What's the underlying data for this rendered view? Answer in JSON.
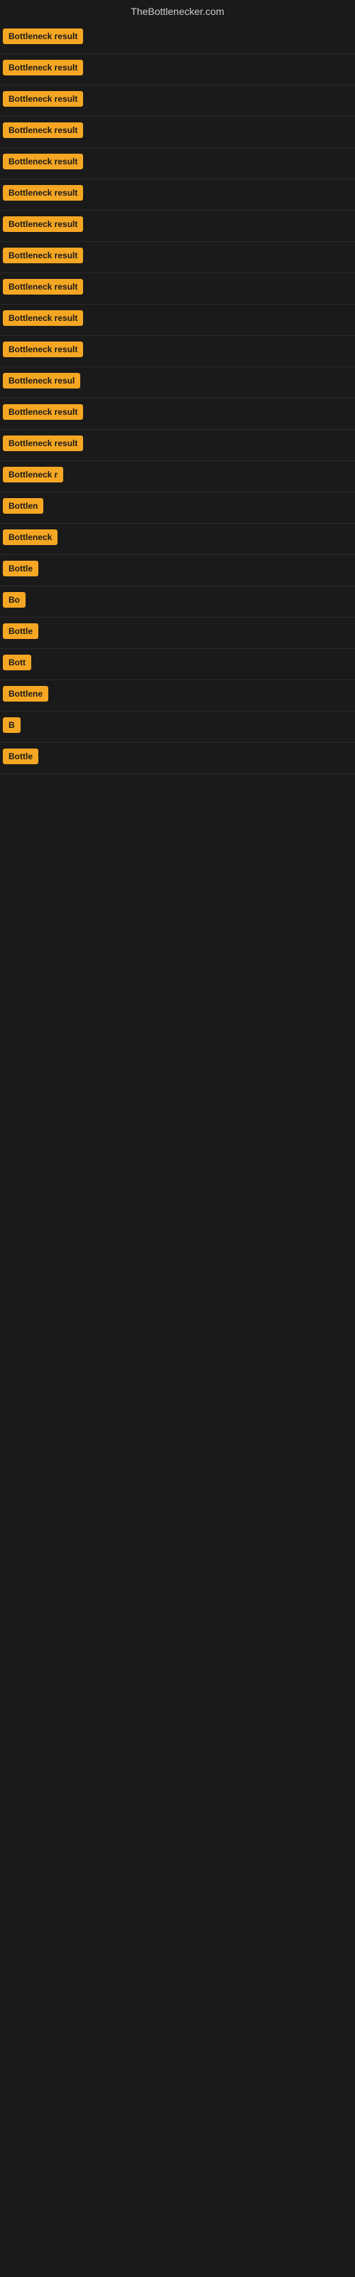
{
  "site": {
    "title": "TheBottlenecker.com"
  },
  "rows": [
    {
      "label": "Bottleneck result",
      "truncated": false
    },
    {
      "label": "Bottleneck result",
      "truncated": false
    },
    {
      "label": "Bottleneck result",
      "truncated": false
    },
    {
      "label": "Bottleneck result",
      "truncated": false
    },
    {
      "label": "Bottleneck result",
      "truncated": false
    },
    {
      "label": "Bottleneck result",
      "truncated": false
    },
    {
      "label": "Bottleneck result",
      "truncated": false
    },
    {
      "label": "Bottleneck result",
      "truncated": false
    },
    {
      "label": "Bottleneck result",
      "truncated": false
    },
    {
      "label": "Bottleneck result",
      "truncated": false
    },
    {
      "label": "Bottleneck result",
      "truncated": false
    },
    {
      "label": "Bottleneck resul",
      "truncated": true
    },
    {
      "label": "Bottleneck result",
      "truncated": false
    },
    {
      "label": "Bottleneck result",
      "truncated": false
    },
    {
      "label": "Bottleneck r",
      "truncated": true
    },
    {
      "label": "Bottlen",
      "truncated": true
    },
    {
      "label": "Bottleneck",
      "truncated": true
    },
    {
      "label": "Bottle",
      "truncated": true
    },
    {
      "label": "Bo",
      "truncated": true
    },
    {
      "label": "Bottle",
      "truncated": true
    },
    {
      "label": "Bott",
      "truncated": true
    },
    {
      "label": "Bottlene",
      "truncated": true
    },
    {
      "label": "B",
      "truncated": true
    },
    {
      "label": "Bottle",
      "truncated": true
    }
  ],
  "colors": {
    "badge_bg": "#f5a623",
    "badge_text": "#1a1a1a",
    "body_bg": "#1a1a1a",
    "site_title": "#cccccc"
  }
}
